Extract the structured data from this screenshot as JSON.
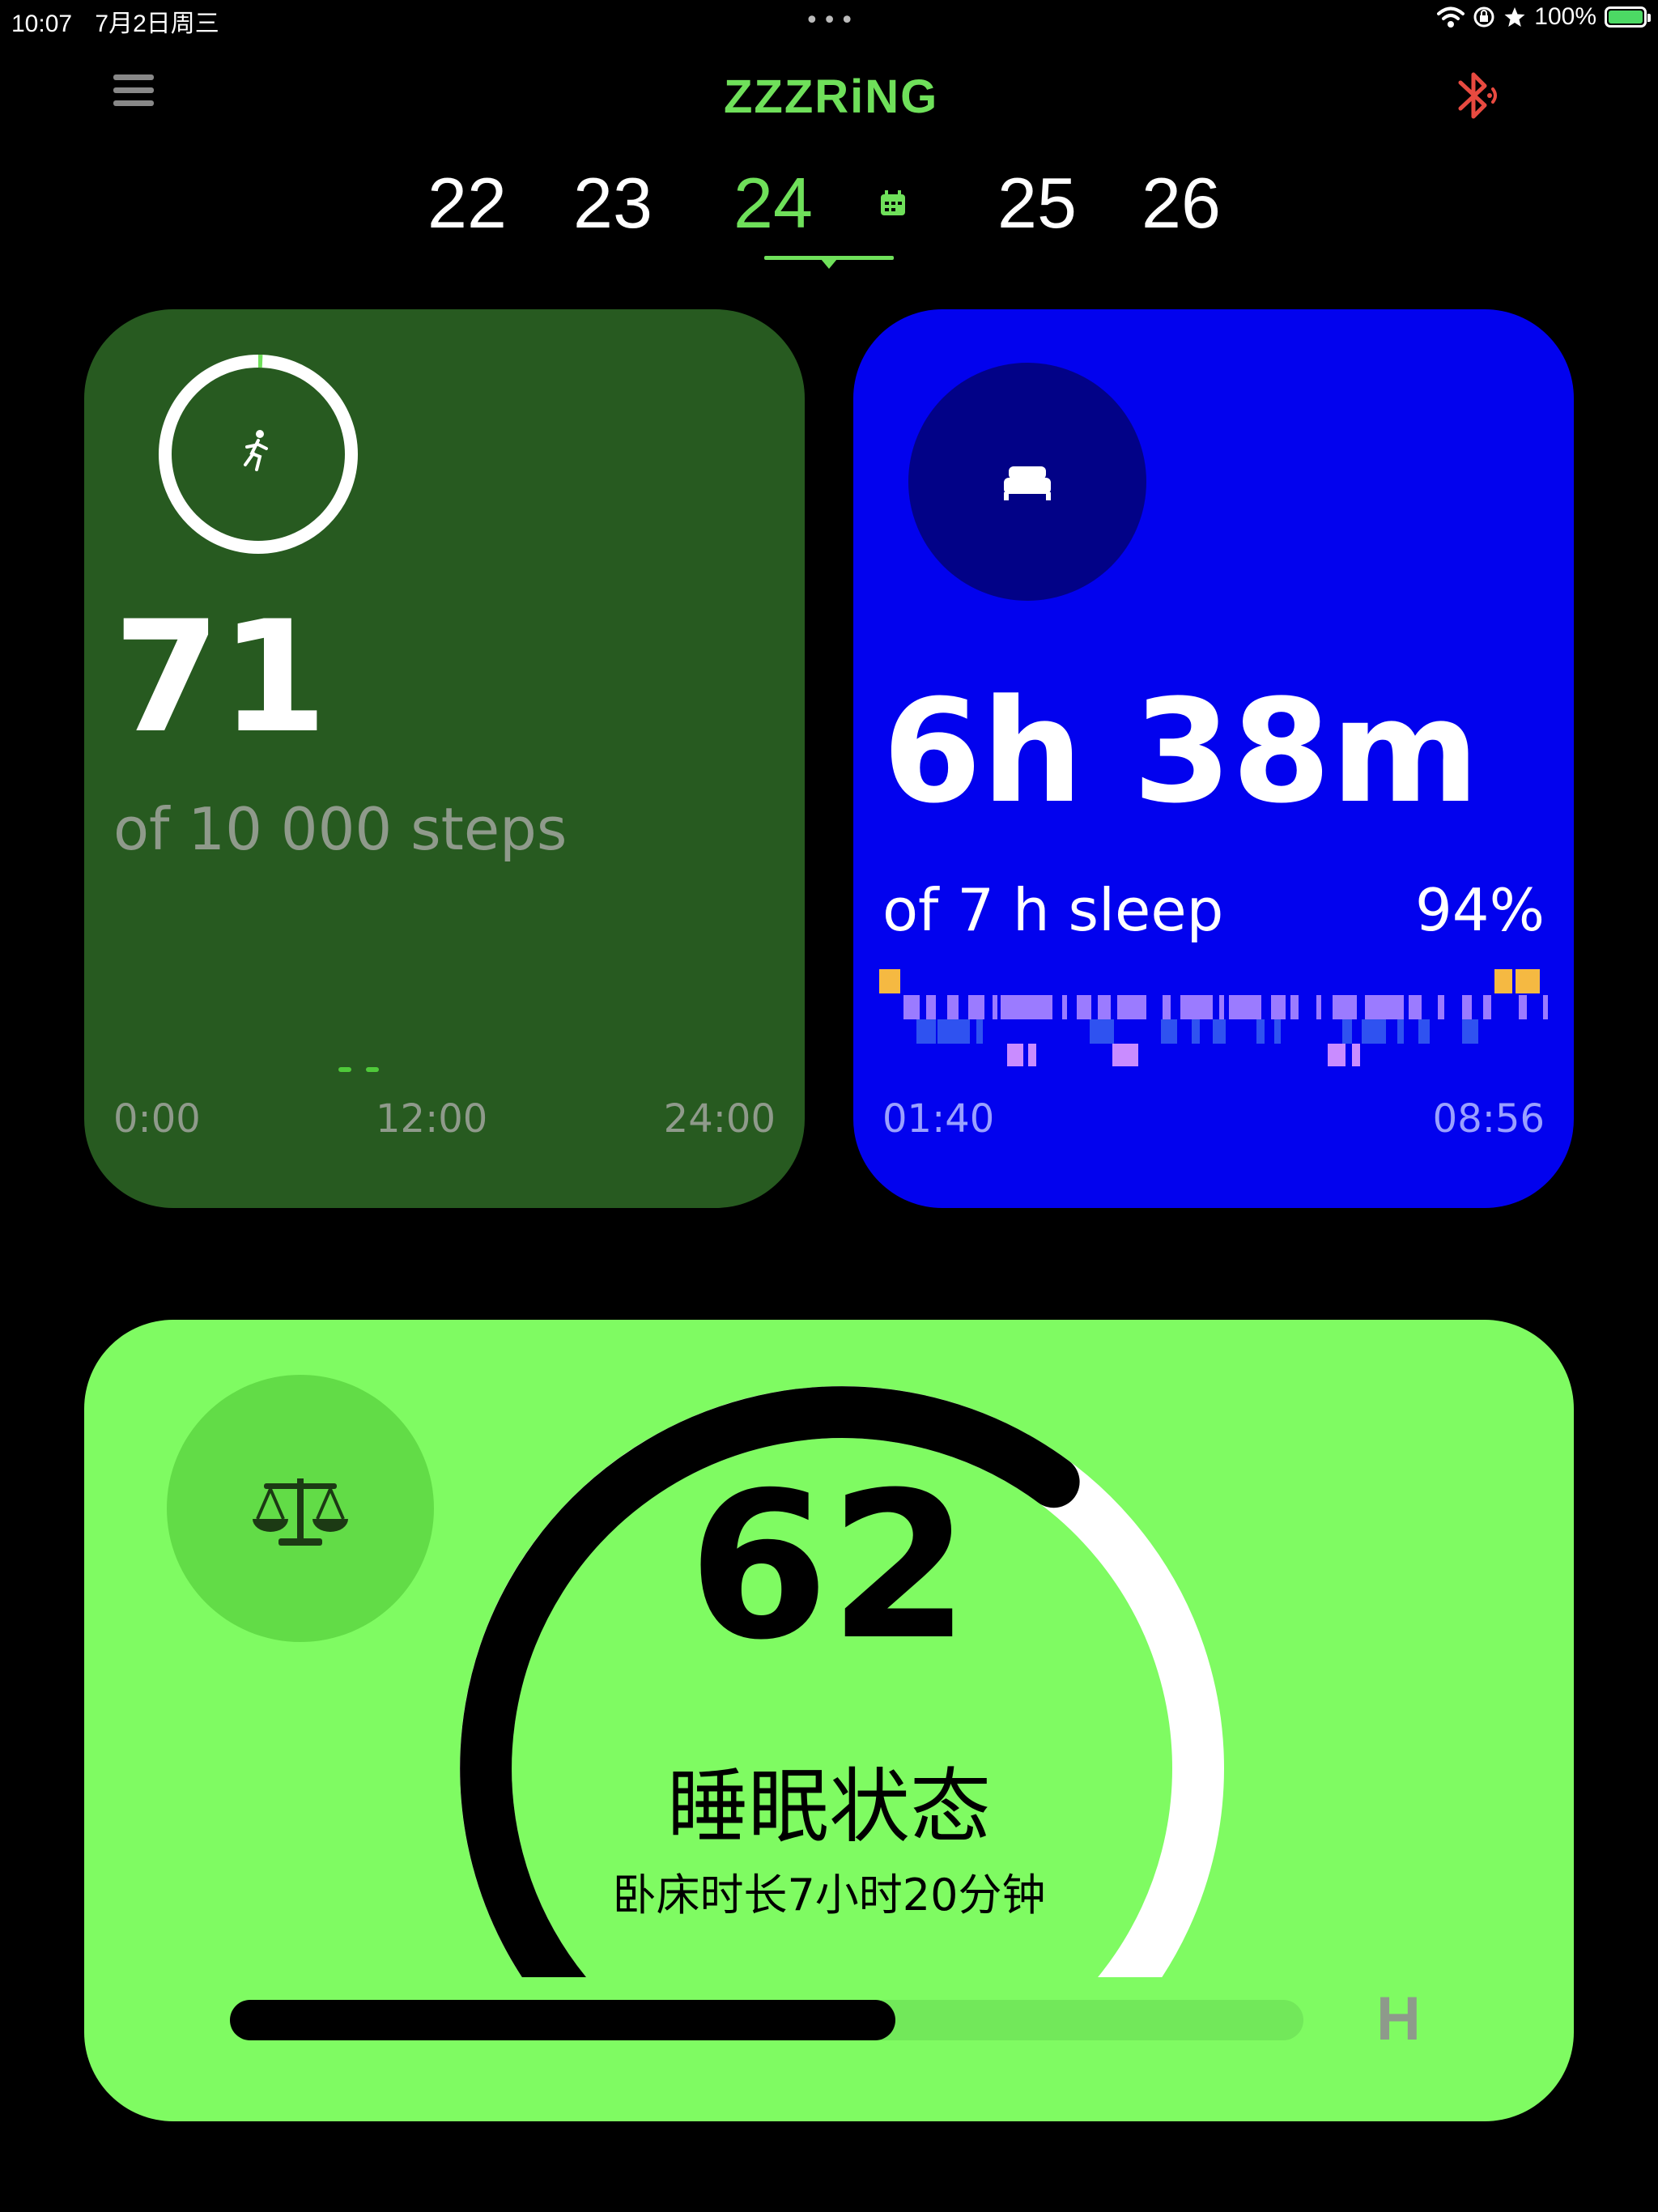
{
  "status_bar": {
    "time": "10:07",
    "date": "7月2日周三",
    "battery": "100%"
  },
  "header": {
    "logo": "ZZZRiNG"
  },
  "dates": {
    "items": [
      "22",
      "23",
      "24",
      "25",
      "26"
    ],
    "selected": "24"
  },
  "steps": {
    "value": "71",
    "goal_label": "of 10 000 steps",
    "axis": [
      "0:00",
      "12:00",
      "24:00"
    ],
    "progress": 0.0071,
    "colors": {
      "card": "#275a20",
      "accent": "#6fe05a"
    }
  },
  "sleep": {
    "value": "6h 38m",
    "goal_label": "of 7 h sleep",
    "percent": "94%",
    "axis_start": "01:40",
    "axis_end": "08:56",
    "colors": {
      "card": "#0202ee",
      "awake": "#f5b942",
      "light": "#9b7bff",
      "deep": "#2f52f0",
      "rem": "#c98cff"
    }
  },
  "sleep_status": {
    "score": "62",
    "title": "睡眠状态",
    "subtitle": "卧床时长7小时20分钟",
    "gauge_fraction": 0.62,
    "bar_fraction": 0.62,
    "bar_label": "H",
    "colors": {
      "card": "#7ffb62"
    }
  }
}
